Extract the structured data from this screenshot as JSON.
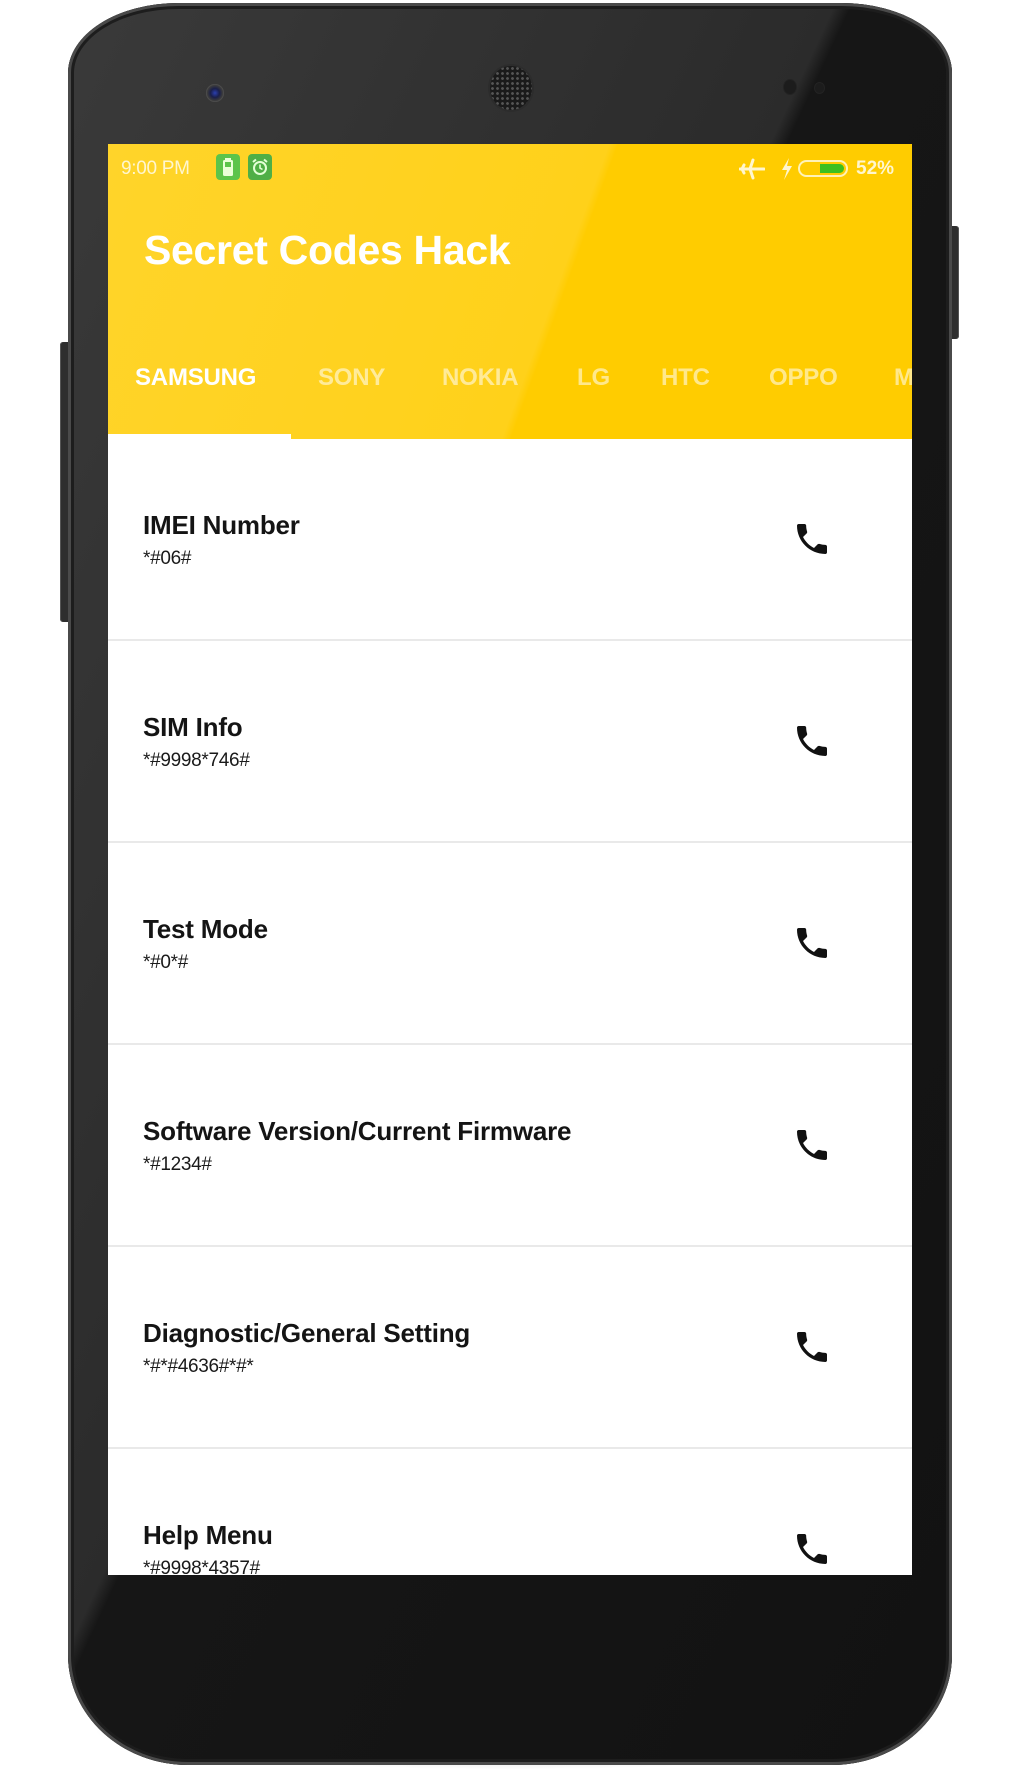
{
  "status_bar": {
    "time": "9:00 PM",
    "notification_icons": [
      "battery-saver-icon",
      "alarm-icon"
    ],
    "system_icons": [
      "airplane-mode-icon",
      "charging-bolt-icon",
      "battery-icon"
    ],
    "battery_percent_text": "52%",
    "battery_level": 0.52,
    "battery_fill_color": "#3cbf1f"
  },
  "app": {
    "title": "Secret Codes Hack",
    "accent_color": "#ffcc00"
  },
  "tabs": [
    {
      "label": "SAMSUNG",
      "active": true
    },
    {
      "label": "SONY",
      "active": false
    },
    {
      "label": "NOKIA",
      "active": false
    },
    {
      "label": "LG",
      "active": false
    },
    {
      "label": "HTC",
      "active": false
    },
    {
      "label": "OPPO",
      "active": false
    },
    {
      "label": "M",
      "active": false
    }
  ],
  "codes": [
    {
      "title": "IMEI Number",
      "code": "*#06#",
      "action_icon": "phone-call-icon"
    },
    {
      "title": "SIM Info",
      "code": "*#9998*746#",
      "action_icon": "phone-call-icon"
    },
    {
      "title": "Test Mode",
      "code": "*#0*#",
      "action_icon": "phone-call-icon"
    },
    {
      "title": "Software Version/Current Firmware",
      "code": "*#1234#",
      "action_icon": "phone-call-icon"
    },
    {
      "title": "Diagnostic/General Setting",
      "code": "*#*#4636#*#*",
      "action_icon": "phone-call-icon"
    },
    {
      "title": "Help Menu",
      "code": "*#9998*4357#",
      "action_icon": "phone-call-icon"
    }
  ]
}
